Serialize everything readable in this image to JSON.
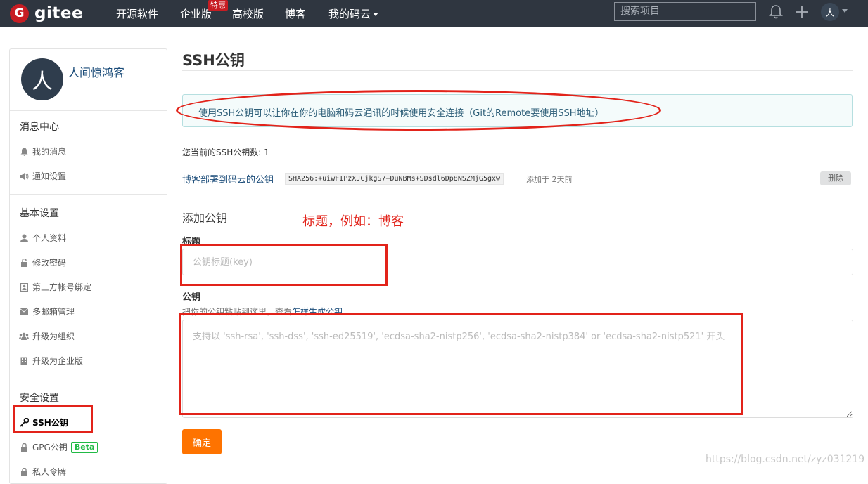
{
  "brand": {
    "logo_letter": "G",
    "name": "gitee"
  },
  "nav": {
    "items": [
      "开源软件",
      "企业版",
      "高校版",
      "博客",
      "我的码云"
    ],
    "hot_badge": "特惠",
    "search_placeholder": "搜索项目",
    "avatar_letter": "人"
  },
  "sidebar": {
    "avatar_letter": "人",
    "username": "人间惊鸿客",
    "sections": [
      {
        "title": "消息中心",
        "items": [
          "我的消息",
          "通知设置"
        ]
      },
      {
        "title": "基本设置",
        "items": [
          "个人资料",
          "修改密码",
          "第三方帐号绑定",
          "多邮箱管理",
          "升级为组织",
          "升级为企业版"
        ]
      },
      {
        "title": "安全设置",
        "items": [
          "SSH公钥",
          "GPG公钥",
          "私人令牌"
        ]
      }
    ],
    "beta_label": "Beta"
  },
  "main": {
    "title": "SSH公钥",
    "info": "使用SSH公钥可以让你在你的电脑和码云通讯的时候使用安全连接（Git的Remote要使用SSH地址）",
    "key_count": "您当前的SSH公钥数: 1",
    "key": {
      "name": "博客部署到码云的公钥",
      "fingerprint": "SHA256:+uiwFIPzXJCjkgS7+DuNBMs+SDsdl6Dp8NSZMjG5gxw",
      "added": "添加于 2天前",
      "delete_label": "删除"
    },
    "add_section_title": "添加公钥",
    "title_label": "标题",
    "title_placeholder": "公钥标题(key)",
    "key_label": "公钥",
    "help_prefix": "把你的公钥粘贴到这里，查看",
    "help_link": "怎样生成公钥",
    "key_placeholder": "支持以 'ssh-rsa', 'ssh-dss', 'ssh-ed25519', 'ecdsa-sha2-nistp256', 'ecdsa-sha2-nistp384' or 'ecdsa-sha2-nistp521' 开头",
    "submit_label": "确定"
  },
  "annotation": {
    "note": "标题，例如：博客",
    "color": "#e2231a"
  },
  "watermark": "https://blog.csdn.net/zyz031219",
  "colors": {
    "topbar": "#2f3640",
    "brand_red": "#c71d23",
    "submit_orange": "#fe7300",
    "beta_green": "#21ba45"
  }
}
